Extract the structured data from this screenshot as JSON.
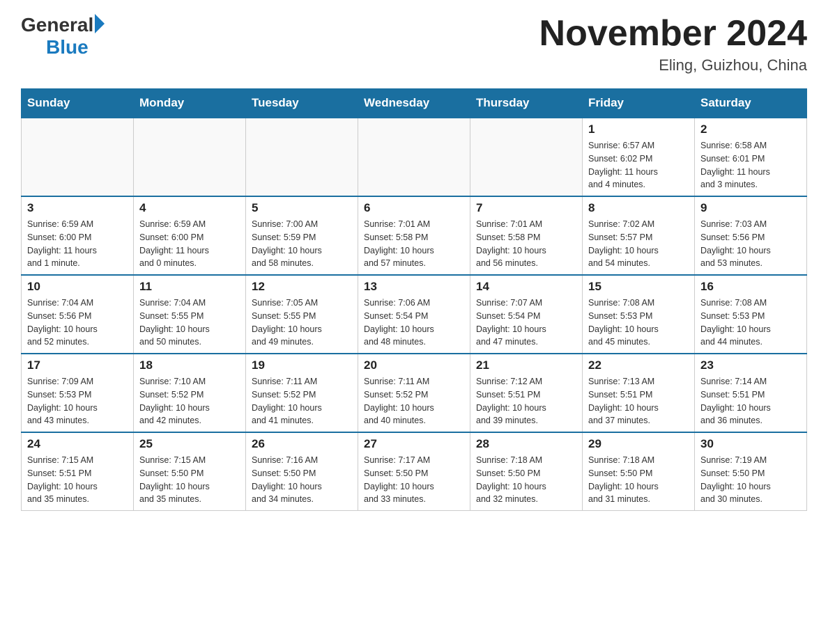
{
  "logo": {
    "general": "General",
    "blue": "Blue"
  },
  "title": "November 2024",
  "subtitle": "Eling, Guizhou, China",
  "days_of_week": [
    "Sunday",
    "Monday",
    "Tuesday",
    "Wednesday",
    "Thursday",
    "Friday",
    "Saturday"
  ],
  "weeks": [
    [
      {
        "day": "",
        "info": ""
      },
      {
        "day": "",
        "info": ""
      },
      {
        "day": "",
        "info": ""
      },
      {
        "day": "",
        "info": ""
      },
      {
        "day": "",
        "info": ""
      },
      {
        "day": "1",
        "info": "Sunrise: 6:57 AM\nSunset: 6:02 PM\nDaylight: 11 hours\nand 4 minutes."
      },
      {
        "day": "2",
        "info": "Sunrise: 6:58 AM\nSunset: 6:01 PM\nDaylight: 11 hours\nand 3 minutes."
      }
    ],
    [
      {
        "day": "3",
        "info": "Sunrise: 6:59 AM\nSunset: 6:00 PM\nDaylight: 11 hours\nand 1 minute."
      },
      {
        "day": "4",
        "info": "Sunrise: 6:59 AM\nSunset: 6:00 PM\nDaylight: 11 hours\nand 0 minutes."
      },
      {
        "day": "5",
        "info": "Sunrise: 7:00 AM\nSunset: 5:59 PM\nDaylight: 10 hours\nand 58 minutes."
      },
      {
        "day": "6",
        "info": "Sunrise: 7:01 AM\nSunset: 5:58 PM\nDaylight: 10 hours\nand 57 minutes."
      },
      {
        "day": "7",
        "info": "Sunrise: 7:01 AM\nSunset: 5:58 PM\nDaylight: 10 hours\nand 56 minutes."
      },
      {
        "day": "8",
        "info": "Sunrise: 7:02 AM\nSunset: 5:57 PM\nDaylight: 10 hours\nand 54 minutes."
      },
      {
        "day": "9",
        "info": "Sunrise: 7:03 AM\nSunset: 5:56 PM\nDaylight: 10 hours\nand 53 minutes."
      }
    ],
    [
      {
        "day": "10",
        "info": "Sunrise: 7:04 AM\nSunset: 5:56 PM\nDaylight: 10 hours\nand 52 minutes."
      },
      {
        "day": "11",
        "info": "Sunrise: 7:04 AM\nSunset: 5:55 PM\nDaylight: 10 hours\nand 50 minutes."
      },
      {
        "day": "12",
        "info": "Sunrise: 7:05 AM\nSunset: 5:55 PM\nDaylight: 10 hours\nand 49 minutes."
      },
      {
        "day": "13",
        "info": "Sunrise: 7:06 AM\nSunset: 5:54 PM\nDaylight: 10 hours\nand 48 minutes."
      },
      {
        "day": "14",
        "info": "Sunrise: 7:07 AM\nSunset: 5:54 PM\nDaylight: 10 hours\nand 47 minutes."
      },
      {
        "day": "15",
        "info": "Sunrise: 7:08 AM\nSunset: 5:53 PM\nDaylight: 10 hours\nand 45 minutes."
      },
      {
        "day": "16",
        "info": "Sunrise: 7:08 AM\nSunset: 5:53 PM\nDaylight: 10 hours\nand 44 minutes."
      }
    ],
    [
      {
        "day": "17",
        "info": "Sunrise: 7:09 AM\nSunset: 5:53 PM\nDaylight: 10 hours\nand 43 minutes."
      },
      {
        "day": "18",
        "info": "Sunrise: 7:10 AM\nSunset: 5:52 PM\nDaylight: 10 hours\nand 42 minutes."
      },
      {
        "day": "19",
        "info": "Sunrise: 7:11 AM\nSunset: 5:52 PM\nDaylight: 10 hours\nand 41 minutes."
      },
      {
        "day": "20",
        "info": "Sunrise: 7:11 AM\nSunset: 5:52 PM\nDaylight: 10 hours\nand 40 minutes."
      },
      {
        "day": "21",
        "info": "Sunrise: 7:12 AM\nSunset: 5:51 PM\nDaylight: 10 hours\nand 39 minutes."
      },
      {
        "day": "22",
        "info": "Sunrise: 7:13 AM\nSunset: 5:51 PM\nDaylight: 10 hours\nand 37 minutes."
      },
      {
        "day": "23",
        "info": "Sunrise: 7:14 AM\nSunset: 5:51 PM\nDaylight: 10 hours\nand 36 minutes."
      }
    ],
    [
      {
        "day": "24",
        "info": "Sunrise: 7:15 AM\nSunset: 5:51 PM\nDaylight: 10 hours\nand 35 minutes."
      },
      {
        "day": "25",
        "info": "Sunrise: 7:15 AM\nSunset: 5:50 PM\nDaylight: 10 hours\nand 35 minutes."
      },
      {
        "day": "26",
        "info": "Sunrise: 7:16 AM\nSunset: 5:50 PM\nDaylight: 10 hours\nand 34 minutes."
      },
      {
        "day": "27",
        "info": "Sunrise: 7:17 AM\nSunset: 5:50 PM\nDaylight: 10 hours\nand 33 minutes."
      },
      {
        "day": "28",
        "info": "Sunrise: 7:18 AM\nSunset: 5:50 PM\nDaylight: 10 hours\nand 32 minutes."
      },
      {
        "day": "29",
        "info": "Sunrise: 7:18 AM\nSunset: 5:50 PM\nDaylight: 10 hours\nand 31 minutes."
      },
      {
        "day": "30",
        "info": "Sunrise: 7:19 AM\nSunset: 5:50 PM\nDaylight: 10 hours\nand 30 minutes."
      }
    ]
  ]
}
